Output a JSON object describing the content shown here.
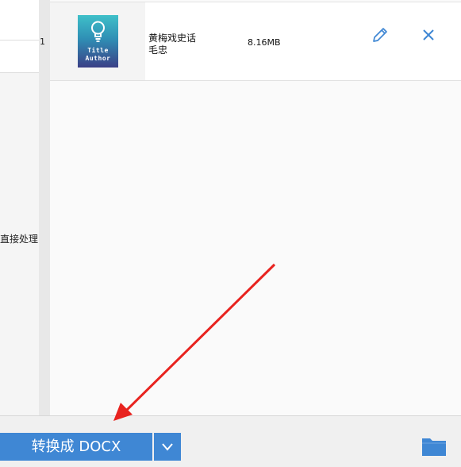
{
  "sidebar": {
    "text": "直接处理"
  },
  "file_list": {
    "rows": [
      {
        "index": "1",
        "cover": {
          "line1": "Title",
          "line2": "Author",
          "icon": "lightbulb-icon"
        },
        "title": "黄梅戏史话",
        "author": "毛忠",
        "size": "8.16MB"
      }
    ]
  },
  "actions": {
    "convert_label": "转换成 DOCX",
    "dropdown_icon": "chevron-down-icon",
    "folder_icon": "folder-icon",
    "edit_icon": "pencil-icon",
    "remove_icon": "close-icon"
  },
  "colors": {
    "accent": "#3f87d4",
    "annotation_arrow": "#e8231f"
  }
}
